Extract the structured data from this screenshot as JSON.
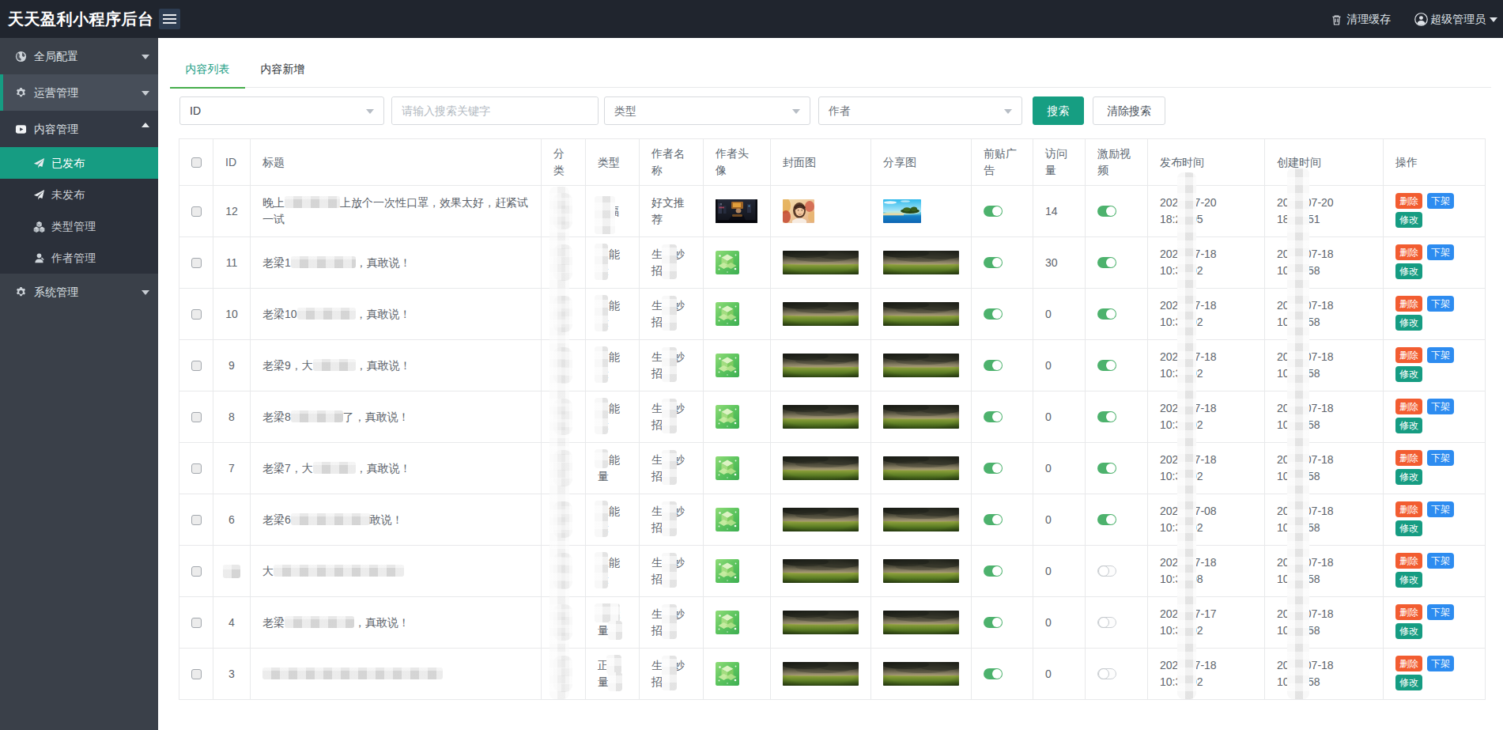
{
  "app": {
    "title": "天天盈利小程序后台",
    "clear_cache_label": "清理缓存",
    "account_label": "超级管理员"
  },
  "sidebar": {
    "items": [
      {
        "label": "全局配置",
        "icon": "globe-icon",
        "state": "collapsed"
      },
      {
        "label": "运营管理",
        "icon": "gear-icon",
        "state": "collapsed",
        "highlighted": true
      },
      {
        "label": "内容管理",
        "icon": "video-icon",
        "state": "expanded",
        "children": [
          {
            "label": "已发布",
            "icon": "paper-plane-icon",
            "active": true
          },
          {
            "label": "未发布",
            "icon": "paper-plane-icon",
            "active": false
          },
          {
            "label": "类型管理",
            "icon": "cubes-icon",
            "active": false
          },
          {
            "label": "作者管理",
            "icon": "user-edit-icon",
            "active": false
          }
        ]
      },
      {
        "label": "系统管理",
        "icon": "gear-icon",
        "state": "collapsed"
      }
    ]
  },
  "main": {
    "tabs": [
      {
        "label": "内容列表",
        "active": true
      },
      {
        "label": "内容新增",
        "active": false
      }
    ],
    "filters": {
      "field_value": "ID",
      "keyword_placeholder": "请输入搜索关键字",
      "type_placeholder": "类型",
      "author_placeholder": "作者",
      "search_label": "搜索",
      "clear_label": "清除搜索"
    },
    "table": {
      "columns": [
        "",
        "ID",
        "标题",
        "分类",
        "类型",
        "作者名称",
        "作者头像",
        "封面图",
        "分享图",
        "前贴广告",
        "访问量",
        "激励视频",
        "发布时间",
        "创建时间",
        "操作"
      ],
      "actions": {
        "delete": "删除",
        "offline": "下架",
        "edit": "修改"
      },
      "rows": [
        {
          "id": "12",
          "id_redacted": false,
          "title": [
            {
              "t": "晚上"
            },
            {
              "b": 70
            },
            {
              "t": "上放个一次性口罩，效果太好，赶紧试一试"
            }
          ],
          "category_redacted": true,
          "type_text": "福",
          "type_indent": 13,
          "type_blobs": [
            [
              -4,
              -9,
              26,
              48
            ]
          ],
          "author": "好文推荐",
          "author_redacted": false,
          "avatar_image": "city",
          "cover_image": "woman",
          "share_image": "beach",
          "preroll_ad": true,
          "visits": "14",
          "incentive_video": true,
          "publish_time": [
            "2020-07-20",
            "18:21:05"
          ],
          "create_time": [
            "2020-07-20",
            "18:10:51"
          ]
        },
        {
          "id": "11",
          "id_redacted": false,
          "title": [
            {
              "t": "老梁1"
            },
            {
              "b": 82
            },
            {
              "t": "，真敢说！"
            }
          ],
          "category_redacted": true,
          "type_text": "正能量",
          "type_indent": 0,
          "type_blobs": [
            [
              -4,
              -3,
              17,
              46
            ]
          ],
          "author": "生活妙招",
          "author_redacted": true,
          "avatar_image": "cube",
          "cover_image": "field",
          "share_image": "field",
          "preroll_ad": true,
          "visits": "30",
          "incentive_video": true,
          "publish_time": [
            "2020-07-18",
            "10:30:02"
          ],
          "create_time": [
            "2020-07-18",
            "10:30:58"
          ]
        },
        {
          "id": "10",
          "id_redacted": false,
          "title": [
            {
              "t": "老梁10"
            },
            {
              "b": 74
            },
            {
              "t": "，真敢说！"
            }
          ],
          "category_redacted": true,
          "type_text": "正能量",
          "type_indent": 0,
          "type_blobs": [
            [
              -4,
              -3,
              17,
              46
            ]
          ],
          "author": "生活妙招",
          "author_redacted": true,
          "avatar_image": "cube",
          "cover_image": "field",
          "share_image": "field",
          "preroll_ad": true,
          "visits": "0",
          "incentive_video": true,
          "publish_time": [
            "2020-07-18",
            "10:30:02"
          ],
          "create_time": [
            "2020-07-18",
            "10:30:58"
          ]
        },
        {
          "id": "9",
          "id_redacted": false,
          "title": [
            {
              "t": "老梁9，大"
            },
            {
              "b": 54
            },
            {
              "t": "，真敢说！"
            }
          ],
          "category_redacted": true,
          "type_text": "正能量",
          "type_indent": 0,
          "type_blobs": [
            [
              -4,
              -3,
              17,
              46
            ]
          ],
          "author": "生活妙招",
          "author_redacted": true,
          "avatar_image": "cube",
          "cover_image": "field",
          "share_image": "field",
          "preroll_ad": true,
          "visits": "0",
          "incentive_video": true,
          "publish_time": [
            "2020-07-18",
            "10:30:02"
          ],
          "create_time": [
            "2020-07-18",
            "10:29:58"
          ]
        },
        {
          "id": "8",
          "id_redacted": false,
          "title": [
            {
              "t": "老梁8"
            },
            {
              "b": 66
            },
            {
              "t": "了，真敢说！"
            }
          ],
          "category_redacted": true,
          "type_text": "正能量",
          "type_indent": 0,
          "type_blobs": [
            [
              -4,
              -3,
              17,
              46
            ]
          ],
          "author": "生活妙招",
          "author_redacted": true,
          "avatar_image": "cube",
          "cover_image": "field",
          "share_image": "field",
          "preroll_ad": true,
          "visits": "0",
          "incentive_video": true,
          "publish_time": [
            "2020-07-18",
            "10:30:02"
          ],
          "create_time": [
            "2020-07-18",
            "10:29:58"
          ]
        },
        {
          "id": "7",
          "id_redacted": false,
          "title": [
            {
              "t": "老梁7，大"
            },
            {
              "b": 54
            },
            {
              "t": "，真敢说！"
            }
          ],
          "category_redacted": true,
          "type_text": "正能量",
          "type_indent": 0,
          "type_blobs": [
            [
              -4,
              -3,
              17,
              24
            ]
          ],
          "author": "生活妙招",
          "author_redacted": true,
          "avatar_image": "cube",
          "cover_image": "field",
          "share_image": "field",
          "preroll_ad": true,
          "visits": "0",
          "incentive_video": true,
          "publish_time": [
            "2020-07-18",
            "10:30:02"
          ],
          "create_time": [
            "2020-07-18",
            "10:29:58"
          ]
        },
        {
          "id": "6",
          "id_redacted": false,
          "title": [
            {
              "t": "老梁6"
            },
            {
              "b": 100
            },
            {
              "t": "敢说！"
            }
          ],
          "category_redacted": true,
          "type_text": "正能量",
          "type_indent": 0,
          "type_blobs": [
            [
              -4,
              -3,
              17,
              46
            ]
          ],
          "author": "生活妙招",
          "author_redacted": true,
          "avatar_image": "cube",
          "cover_image": "field",
          "share_image": "field",
          "preroll_ad": true,
          "visits": "0",
          "incentive_video": true,
          "publish_time": [
            "2020-07-08",
            "10:30:02"
          ],
          "create_time": [
            "2020-07-18",
            "10:29:58"
          ]
        },
        {
          "id": "",
          "id_redacted": true,
          "title": [
            {
              "t": "大"
            },
            {
              "b": 165
            }
          ],
          "category_redacted": true,
          "type_text": "正能量",
          "type_indent": 0,
          "type_blobs": [
            [
              -4,
              -3,
              17,
              46
            ]
          ],
          "author": "生活妙招",
          "author_redacted": true,
          "avatar_image": "cube",
          "cover_image": "field",
          "share_image": "field",
          "preroll_ad": true,
          "visits": "0",
          "incentive_video": false,
          "publish_time": [
            "2020-07-18",
            "10:30:08"
          ],
          "create_time": [
            "2020-07-18",
            "10:29:58"
          ]
        },
        {
          "id": "4",
          "id_redacted": false,
          "title": [
            {
              "t": "老梁"
            },
            {
              "b": 88
            },
            {
              "t": "，真敢说！"
            }
          ],
          "category_redacted": true,
          "type_text": "正能量",
          "type_indent": 0,
          "type_blobs": [
            [
              -4,
              -3,
              32,
              24
            ],
            [
              13,
              19,
              18,
              24
            ]
          ],
          "author": "生活妙招",
          "author_redacted": true,
          "avatar_image": "cube",
          "cover_image": "field",
          "share_image": "field",
          "preroll_ad": true,
          "visits": "0",
          "incentive_video": false,
          "publish_time": [
            "2020-07-17",
            "10:30:02"
          ],
          "create_time": [
            "2020-07-18",
            "10:29:58"
          ]
        },
        {
          "id": "3",
          "id_redacted": false,
          "title": [
            {
              "b": 228
            }
          ],
          "category_redacted": true,
          "type_text": "正能量",
          "type_indent": 0,
          "type_blobs": [
            [
              11,
              -3,
              19,
              24
            ],
            [
              13,
              19,
              18,
              24
            ]
          ],
          "author": "生活妙招",
          "author_redacted": true,
          "avatar_image": "cube",
          "cover_image": "field",
          "share_image": "field",
          "preroll_ad": true,
          "visits": "0",
          "incentive_video": false,
          "publish_time": [
            "2020-07-18",
            "10:30:02"
          ],
          "create_time": [
            "2020-07-18",
            "10:29:58"
          ]
        }
      ]
    }
  },
  "colors": {
    "accent_teal": "#169c82",
    "tab_underline_green": "#45ae4b",
    "toggle_green": "#4db26d",
    "delete_button": "#f25d31",
    "offline_button": "#2d8cf0",
    "edit_button": "#169c82",
    "topbar_background": "#20252e",
    "sidebar_background": "#3a4049"
  }
}
